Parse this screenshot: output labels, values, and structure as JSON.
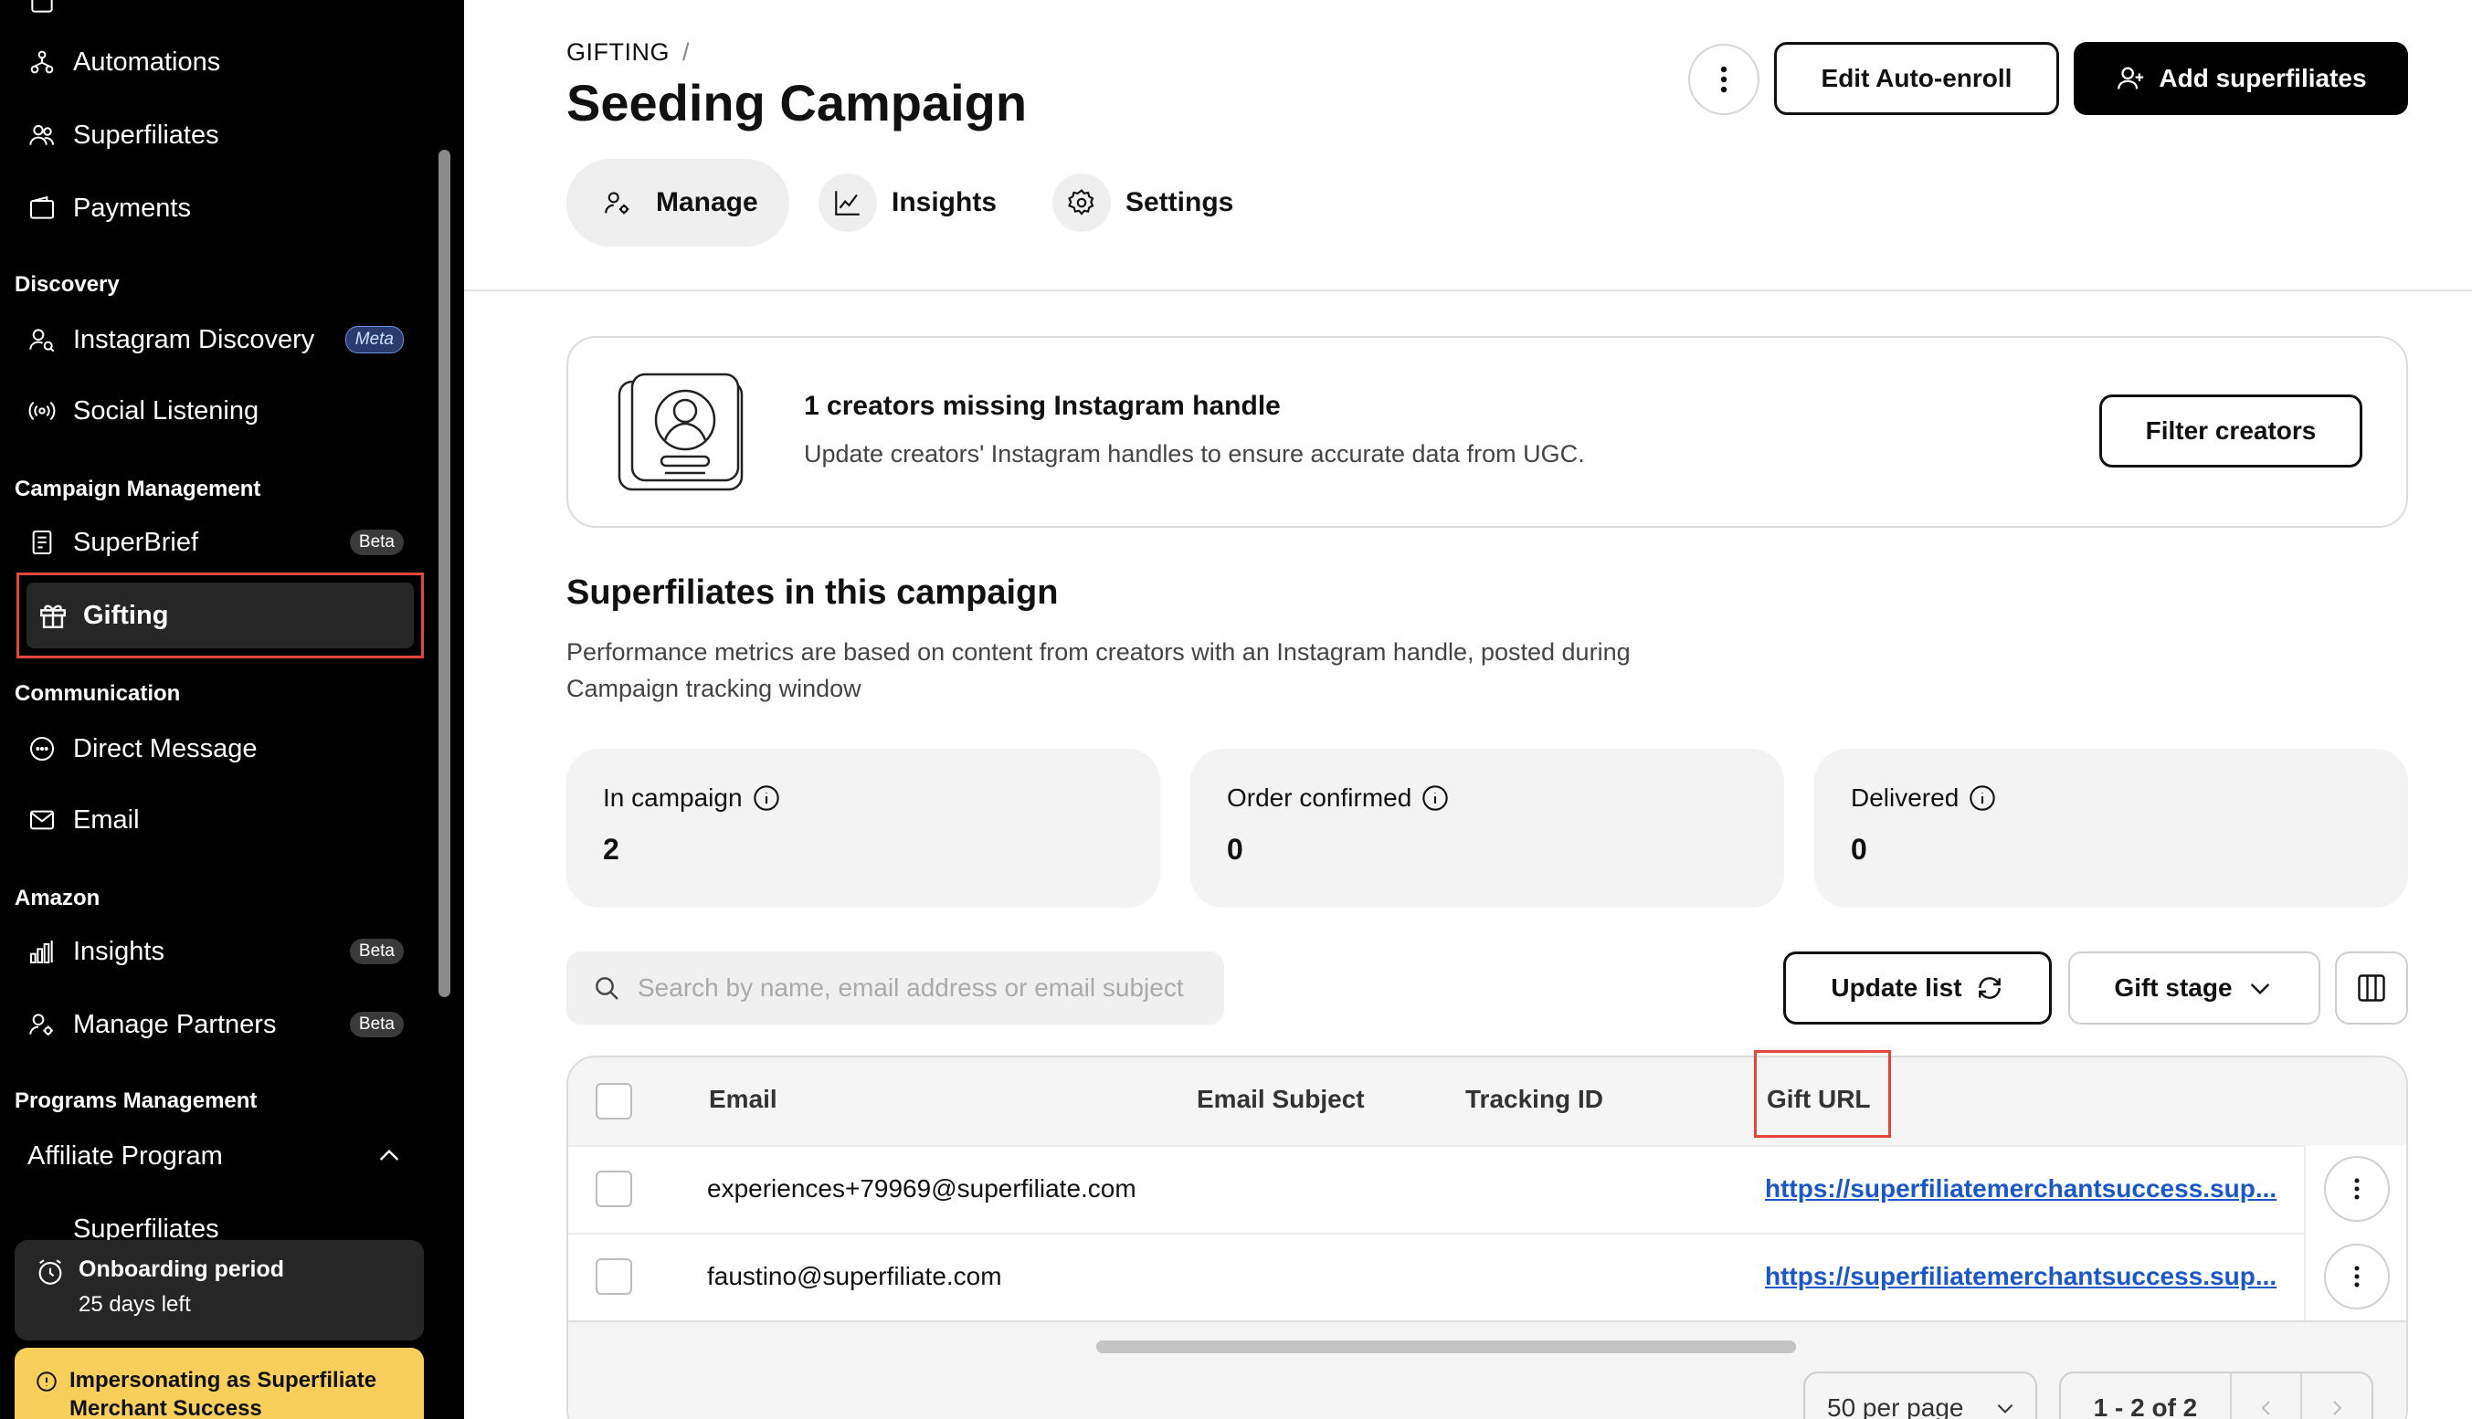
{
  "sidebar": {
    "items_top": [
      {
        "label": "Automations",
        "icon": "automations-icon"
      },
      {
        "label": "Superfiliates",
        "icon": "users-icon"
      },
      {
        "label": "Payments",
        "icon": "wallet-icon"
      }
    ],
    "sections": {
      "discovery": "Discovery",
      "campaign_management": "Campaign Management",
      "communication": "Communication",
      "amazon": "Amazon",
      "programs_management": "Programs Management"
    },
    "instagram_discovery": {
      "label": "Instagram Discovery",
      "badge": "Meta"
    },
    "social_listening": {
      "label": "Social Listening"
    },
    "superbrief": {
      "label": "SuperBrief",
      "badge": "Beta"
    },
    "gifting": {
      "label": "Gifting"
    },
    "direct_message": {
      "label": "Direct Message"
    },
    "email": {
      "label": "Email"
    },
    "insights": {
      "label": "Insights",
      "badge": "Beta"
    },
    "manage_partners": {
      "label": "Manage Partners",
      "badge": "Beta"
    },
    "affiliate_program": {
      "label": "Affiliate Program"
    },
    "superfiliates_sub": {
      "label": "Superfiliates"
    },
    "onboarding": {
      "title": "Onboarding period",
      "subtitle": "25 days left"
    },
    "impersonating": {
      "text": "Impersonating as Superfiliate Merchant Success"
    }
  },
  "header": {
    "breadcrumb": "GIFTING",
    "breadcrumb_sep": "/",
    "title": "Seeding Campaign",
    "edit_auto_enroll": "Edit Auto-enroll",
    "add_superfiliates": "Add superfiliates"
  },
  "tabs": [
    {
      "label": "Manage",
      "icon": "manage-icon",
      "active": true
    },
    {
      "label": "Insights",
      "icon": "chart-icon",
      "active": false
    },
    {
      "label": "Settings",
      "icon": "gear-icon",
      "active": false
    }
  ],
  "alert": {
    "title": "1 creators missing Instagram handle",
    "description": "Update creators' Instagram handles to ensure accurate data from UGC.",
    "button": "Filter creators"
  },
  "section": {
    "title": "Superfiliates in this campaign",
    "description": "Performance metrics are based on content from creators with an Instagram handle, posted during Campaign tracking window"
  },
  "stats": [
    {
      "label": "In campaign",
      "value": "2"
    },
    {
      "label": "Order confirmed",
      "value": "0"
    },
    {
      "label": "Delivered",
      "value": "0"
    }
  ],
  "toolbar": {
    "search_placeholder": "Search by name, email address or email subject",
    "update_list": "Update list",
    "gift_stage": "Gift stage"
  },
  "table": {
    "columns": [
      "Email",
      "Email Subject",
      "Tracking ID",
      "Gift URL"
    ],
    "rows": [
      {
        "email": "experiences+79969@superfiliate.com",
        "email_subject": "",
        "tracking_id": "",
        "gift_url": "https://superfiliatemerchantsuccess.sup..."
      },
      {
        "email": "faustino@superfiliate.com",
        "email_subject": "",
        "tracking_id": "",
        "gift_url": "https://superfiliatemerchantsuccess.sup..."
      }
    ]
  },
  "pagination": {
    "per_page": "50 per page",
    "range": "1 - 2 of 2"
  },
  "colors": {
    "highlight": "#e5463a",
    "link": "#1a57c9",
    "warning": "#f8cf5a"
  }
}
